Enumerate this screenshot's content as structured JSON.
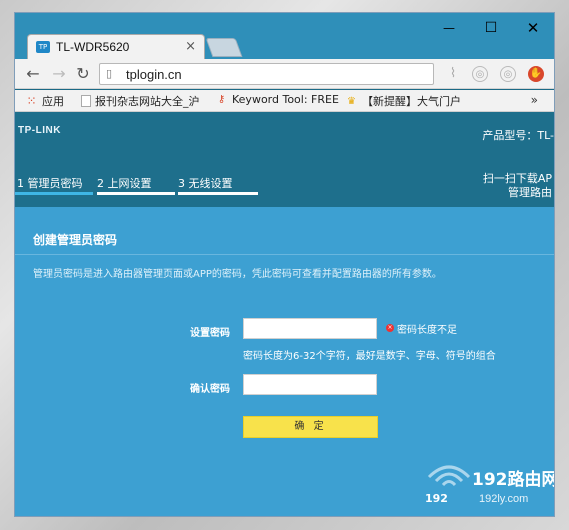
{
  "browser": {
    "tab_title": "TL-WDR5620",
    "tab_favicon": "TP",
    "window_controls": {
      "minimize": "—",
      "maximize": "☐",
      "close": "✕"
    },
    "url": "tplogin.cn",
    "bookmarks": [
      {
        "label": "应用",
        "icon": "apps-grid-icon"
      },
      {
        "label": "报刊杂志网站大全_沪",
        "icon": "page-icon"
      },
      {
        "label": "Keyword Tool: FREE",
        "icon": "key-icon"
      },
      {
        "label": "【新提醒】大气门户",
        "icon": "trophy-icon"
      }
    ],
    "bookmarks_more": "»"
  },
  "router": {
    "brand": "TP-LINK",
    "model_label": "产品型号：TL-",
    "steps": [
      "1 管理员密码",
      "2 上网设置",
      "3 无线设置"
    ],
    "scan_text": [
      "扫一扫下载AP",
      "管理路由"
    ],
    "form": {
      "title": "创建管理员密码",
      "description": "管理员密码是进入路由器管理页面或APP的密码，凭此密码可查看并配置路由器的所有参数。",
      "password_label": "设置密码",
      "password_value": "",
      "error_text": "密码长度不足",
      "hint": "密码长度为6-32个字符，最好是数字、字母、符号的组合",
      "confirm_label": "确认密码",
      "confirm_value": "",
      "submit_label": "确 定"
    }
  },
  "watermark": {
    "name": "192路由网",
    "sub": "192",
    "url": "192ly.com"
  },
  "colors": {
    "page_bg": "#1e6f8c",
    "panel_bg": "#3da0d2",
    "button_bg": "#f8e24b",
    "error": "#e33333"
  }
}
